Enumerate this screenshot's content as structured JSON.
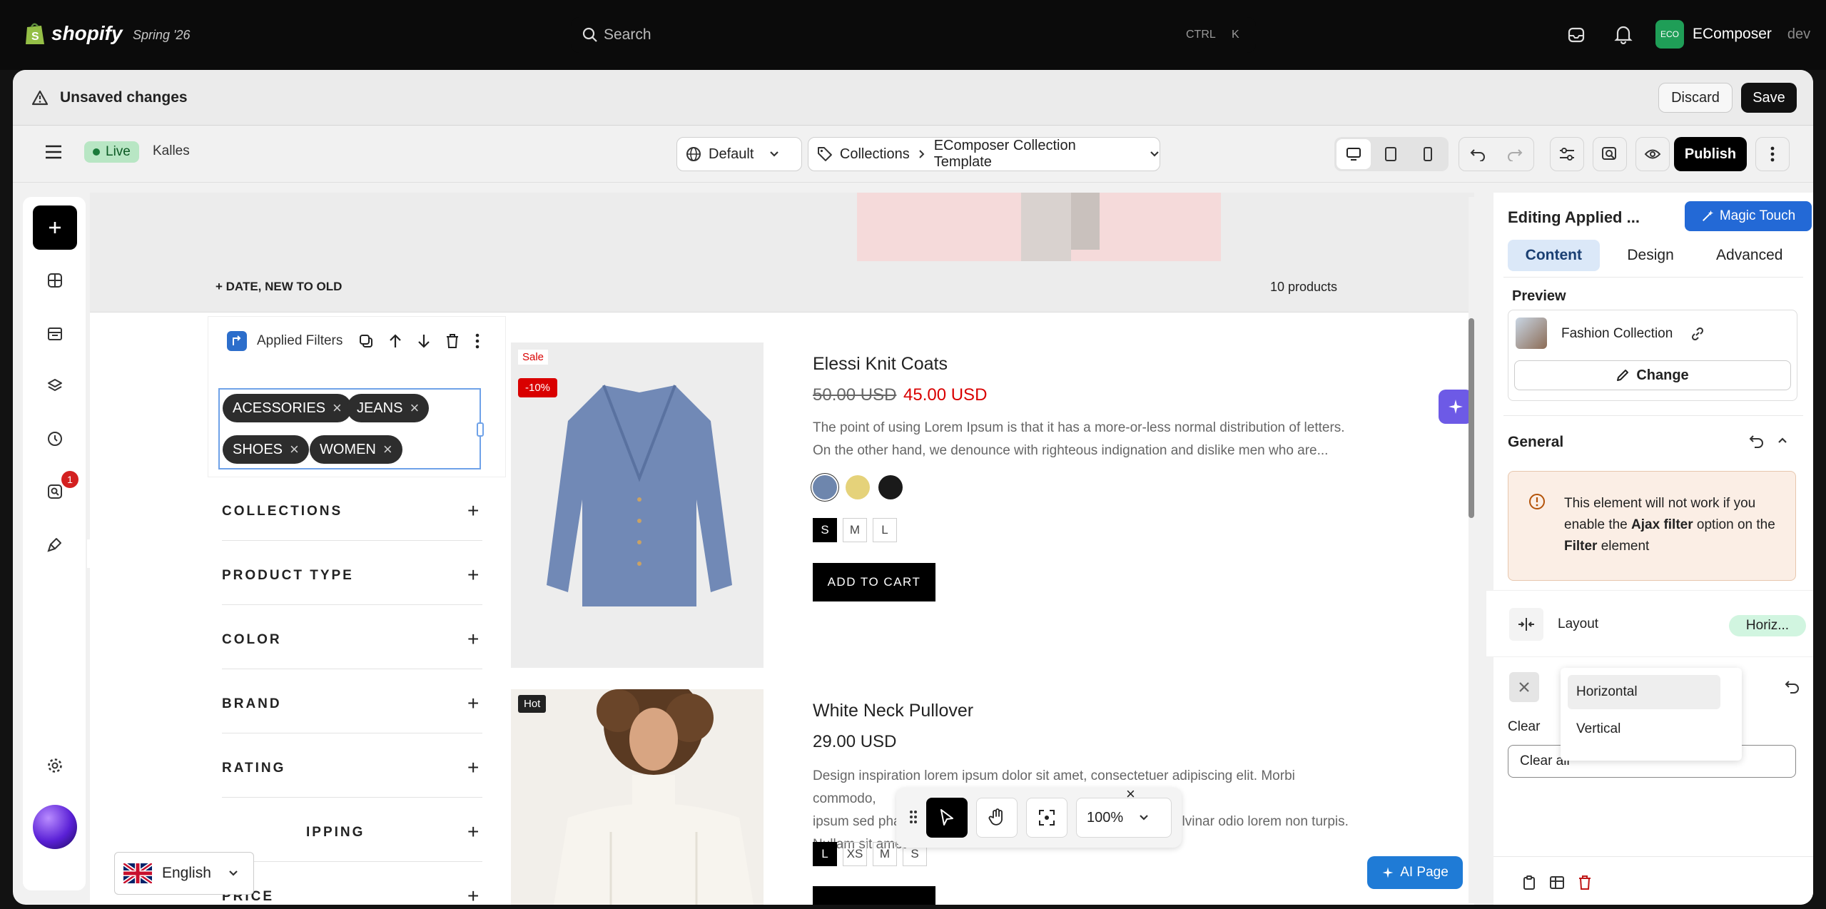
{
  "shopify": {
    "logo": "shopify",
    "edition": "Spring '26",
    "search_placeholder": "Search",
    "shortcut_ctrl": "CTRL",
    "shortcut_k": "K",
    "store_badge": "ECO",
    "store_name": "EComposer",
    "store_suffix": "dev"
  },
  "unsaved": {
    "title": "Unsaved changes",
    "discard": "Discard",
    "save": "Save"
  },
  "toolbar": {
    "status": "Live",
    "theme": "Kalles",
    "locale": "Default",
    "crumb_root": "Collections",
    "crumb_template": "EComposer Collection Template",
    "publish": "Publish"
  },
  "sidebar": {
    "notification_count": "1"
  },
  "canvas": {
    "sort_label": "+ DATE, NEW TO OLD",
    "product_count": "10 products",
    "element_toolbar_label": "Applied Filters",
    "chips": [
      "ACESSORIES",
      "JEANS",
      "SHOES",
      "WOMEN"
    ],
    "chip_close": "×",
    "filters": [
      {
        "label": "COLLECTIONS"
      },
      {
        "label": "PRODUCT TYPE"
      },
      {
        "label": "COLOR"
      },
      {
        "label": "BRAND"
      },
      {
        "label": "RATING"
      },
      {
        "label": "IPPING"
      },
      {
        "label": "PRICE"
      }
    ],
    "filter_plus": "+",
    "language": "English",
    "products": [
      {
        "badge_sale": "Sale",
        "badge_discount": "-10%",
        "title": "Elessi Knit Coats",
        "old_price": "50.00 USD",
        "price": "45.00 USD",
        "description": "The point of using Lorem Ipsum is that it has a more-or-less normal distribution of letters. On the other hand, we denounce with righteous indignation and dislike men who are...",
        "sizes": [
          "S",
          "M",
          "L"
        ],
        "cta": "ADD TO CART",
        "swatch_colors": [
          "#6e86ad",
          "#e5d27a",
          "#1a1a1a"
        ]
      },
      {
        "badge_hot": "Hot",
        "title": "White Neck Pullover",
        "price": "29.00 USD",
        "description_lines": [
          "Design inspiration lorem ipsum dolor sit amet, consectetuer adipiscing elit. Morbi commodo,",
          "ipsum sed pharetra gravida, orci magna rhoncus neque, id pulvinar odio lorem non turpis.",
          "Nullam sit amet"
        ],
        "sizes": [
          "L",
          "XS",
          "M",
          "S"
        ]
      }
    ],
    "zoom": "100%",
    "close_glyph": "×",
    "ai_page": "AI Page"
  },
  "panel": {
    "title": "Editing Applied ...",
    "magic": "Magic Touch",
    "tabs": [
      "Content",
      "Design",
      "Advanced"
    ],
    "preview_label": "Preview",
    "preview_collection": "Fashion Collection",
    "change": "Change",
    "general": "General",
    "warning_pre": "This element will not work if you enable the ",
    "warning_bold1": "Ajax filter",
    "warning_mid": " option on the ",
    "warning_bold2": "Filter",
    "warning_post": " element",
    "layout_label": "Layout",
    "layout_value": "Horiz...",
    "options": [
      "Horizontal",
      "Vertical"
    ],
    "clear_label": "Clear",
    "clear_input": "Clear all"
  },
  "colors": {
    "accent_blue": "#2c6ecb",
    "magic_blue": "#2369d6",
    "publish": "#000000",
    "sale_red": "#d90000",
    "warning_bg": "#fbeee5",
    "live_green": "#b8e6c4"
  }
}
